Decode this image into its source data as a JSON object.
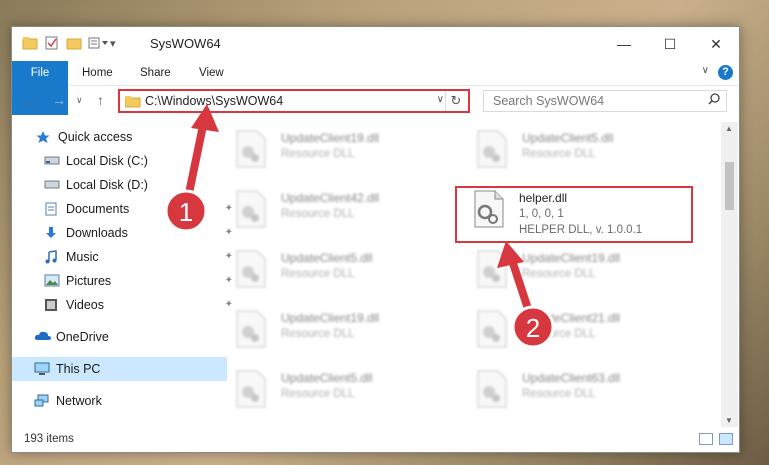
{
  "window": {
    "title": "SysWOW64",
    "controls": [
      "—",
      "☐",
      "✕"
    ]
  },
  "ribbon": {
    "tabs": [
      "File",
      "Home",
      "Share",
      "View"
    ],
    "help": "?",
    "collapse": "∨"
  },
  "nav": {
    "back": "←",
    "forward": "→",
    "recent": "∨",
    "up": "↑",
    "address": "C:\\Windows\\SysWOW64",
    "address_dropdown": "∨",
    "refresh": "↻",
    "search_placeholder": "Search SysWOW64"
  },
  "sidebar": {
    "items": [
      {
        "label": "Quick access",
        "icon": "star-icon"
      },
      {
        "label": "Local Disk (C:)",
        "icon": "drive-icon"
      },
      {
        "label": "Local Disk (D:)",
        "icon": "drive-icon"
      },
      {
        "label": "Documents",
        "icon": "documents-icon"
      },
      {
        "label": "Downloads",
        "icon": "download-icon"
      },
      {
        "label": "Music",
        "icon": "music-icon"
      },
      {
        "label": "Pictures",
        "icon": "pictures-icon"
      },
      {
        "label": "Videos",
        "icon": "videos-icon"
      },
      {
        "label": "OneDrive",
        "icon": "cloud-icon"
      },
      {
        "label": "This PC",
        "icon": "computer-icon"
      },
      {
        "label": "Network",
        "icon": "network-icon"
      }
    ],
    "pin": "📌"
  },
  "files": [
    {
      "name": "UpdateClient19.dll",
      "type": "Resource DLL",
      "desc": ""
    },
    {
      "name": "UpdateClient5.dll",
      "type": "Resource DLL",
      "desc": ""
    },
    {
      "name": "UpdateClient42.dll",
      "type": "Resource DLL",
      "desc": ""
    },
    {
      "name": "helper.dll",
      "type": "1, 0, 0, 1",
      "desc": "HELPER DLL, v. 1.0.0.1"
    },
    {
      "name": "UpdateClient5.dll",
      "type": "Resource DLL",
      "desc": ""
    },
    {
      "name": "UpdateClient19.dll",
      "type": "Resource DLL",
      "desc": ""
    },
    {
      "name": "UpdateClient19.dll",
      "type": "Resource DLL",
      "desc": ""
    },
    {
      "name": "UpdateClient21.dll",
      "type": "Resource DLL",
      "desc": ""
    },
    {
      "name": "UpdateClient5.dll",
      "type": "Resource DLL",
      "desc": ""
    },
    {
      "name": "UpdateClient63.dll",
      "type": "Resource DLL",
      "desc": ""
    }
  ],
  "status": {
    "count": "193 items"
  },
  "annotations": {
    "step1": "1",
    "step2": "2",
    "color": "#d7373f"
  }
}
